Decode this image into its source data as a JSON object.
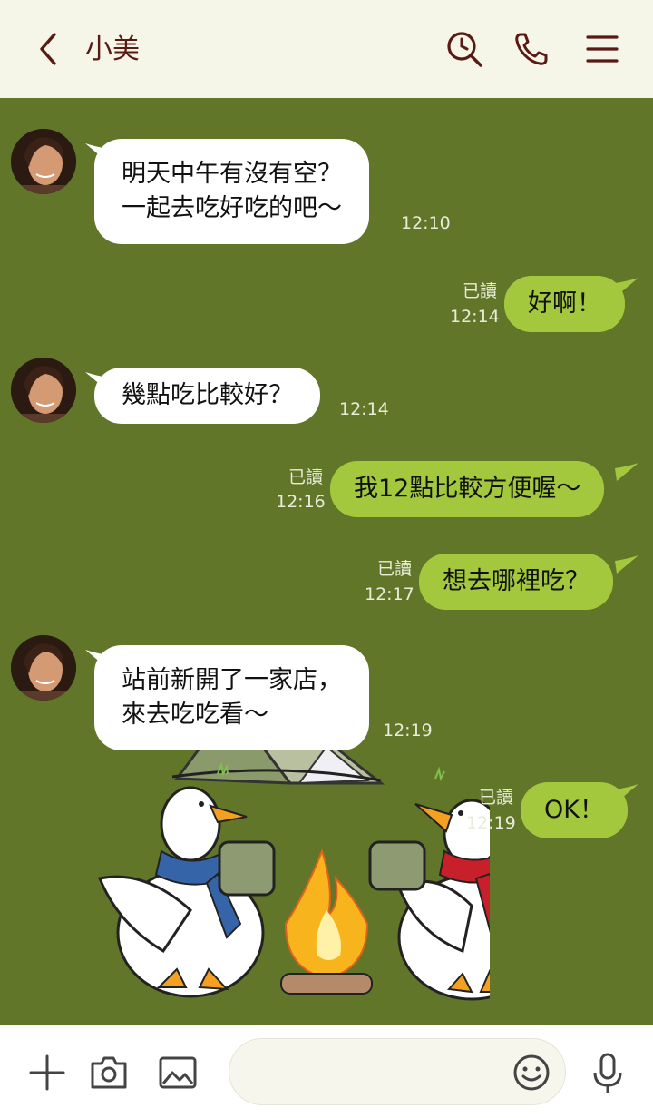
{
  "header": {
    "title": "小美",
    "icons": [
      "back-chevron-icon",
      "search-clock-icon",
      "phone-icon",
      "menu-icon"
    ]
  },
  "messages": [
    {
      "side": "in",
      "lines": [
        "明天中午有沒有空？",
        "一起去吃好吃的吧～"
      ],
      "time": "12:10"
    },
    {
      "side": "out",
      "text": "好啊！",
      "read": "已讀",
      "time": "12:14"
    },
    {
      "side": "in",
      "lines": [
        "幾點吃比較好？"
      ],
      "time": "12:14"
    },
    {
      "side": "out",
      "text": "我12點比較方便喔～",
      "read": "已讀",
      "time": "12:16"
    },
    {
      "side": "out",
      "text": "想去哪裡吃？",
      "read": "已讀",
      "time": "12:17"
    },
    {
      "side": "in",
      "lines": [
        "站前新開了一家店，",
        "來去吃吃看～"
      ],
      "time": "12:19"
    },
    {
      "side": "out",
      "text": "OK！",
      "read": "已讀",
      "time": "12:19"
    }
  ],
  "bottom": {
    "icons": [
      "plus-icon",
      "camera-icon",
      "image-icon",
      "emoji-icon",
      "mic-icon"
    ],
    "input_value": ""
  },
  "theme": {
    "background": "#62762a",
    "header_bg": "#f5f5e8",
    "accent": "#5a1a14",
    "incoming_bubble": "#ffffff",
    "outgoing_bubble": "#a3c83e"
  }
}
